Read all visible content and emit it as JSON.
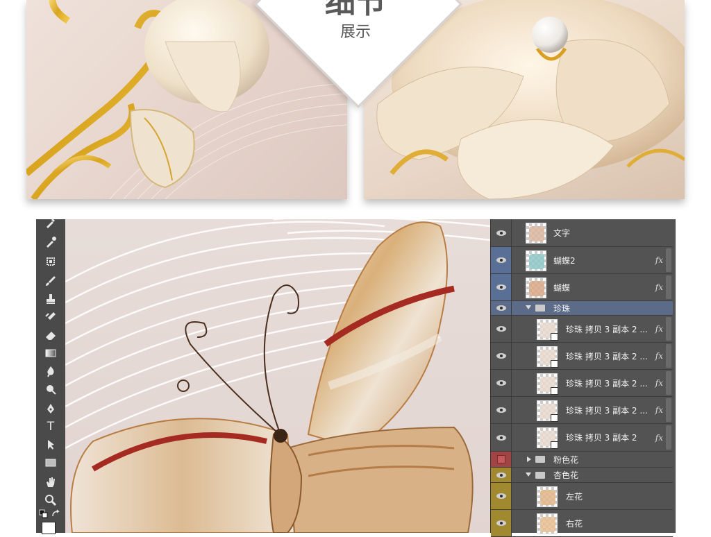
{
  "showcase": {
    "title": "细节",
    "subtitle": "展示"
  },
  "toolbar": {
    "tools": [
      {
        "name": "eyedropper-partial-icon",
        "glyph": "✒"
      },
      {
        "name": "eyedropper-icon",
        "glyph": "✎"
      },
      {
        "name": "spot-healing-icon",
        "glyph": "✺"
      },
      {
        "name": "brush-icon",
        "glyph": "✐"
      },
      {
        "name": "clone-stamp-icon",
        "glyph": "⊥"
      },
      {
        "name": "history-brush-icon",
        "glyph": "✍"
      },
      {
        "name": "eraser-icon",
        "glyph": "◪"
      },
      {
        "name": "gradient-icon",
        "glyph": "▭"
      },
      {
        "name": "blur-icon",
        "glyph": "◖"
      },
      {
        "name": "dodge-icon",
        "glyph": "●"
      },
      {
        "name": "pen-icon",
        "glyph": "✒"
      },
      {
        "name": "type-icon",
        "glyph": "T"
      },
      {
        "name": "path-selection-icon",
        "glyph": "▸"
      },
      {
        "name": "rectangle-icon",
        "glyph": "▭"
      },
      {
        "name": "hand-icon",
        "glyph": "✋"
      },
      {
        "name": "zoom-icon",
        "glyph": "⚲"
      },
      {
        "name": "swap-colors-icon",
        "glyph": "⇄"
      }
    ]
  },
  "layers": [
    {
      "label": "文字",
      "type": "layer",
      "fx": "",
      "eye": "normal"
    },
    {
      "label": "蝴蝶2",
      "type": "layer",
      "fx": "fx",
      "eye": "blue"
    },
    {
      "label": "蝴蝶",
      "type": "layer",
      "fx": "fx",
      "eye": "blue"
    },
    {
      "label": "珍珠",
      "type": "group-open",
      "fx": "",
      "eye": "normal"
    },
    {
      "label": "珍珠 拷贝 3 副本 2 ...",
      "type": "smart",
      "fx": "fx",
      "eye": "normal"
    },
    {
      "label": "珍珠 拷贝 3 副本 2 ...",
      "type": "smart",
      "fx": "fx",
      "eye": "normal"
    },
    {
      "label": "珍珠 拷贝 3 副本 2 ...",
      "type": "smart",
      "fx": "fx",
      "eye": "normal"
    },
    {
      "label": "珍珠 拷贝 3 副本 2 ...",
      "type": "smart",
      "fx": "fx",
      "eye": "normal"
    },
    {
      "label": "珍珠 拷贝 3 副本 2",
      "type": "smart",
      "fx": "fx",
      "eye": "normal"
    },
    {
      "label": "粉色花",
      "type": "group-closed",
      "fx": "",
      "eye": "red"
    },
    {
      "label": "杏色花",
      "type": "group-open",
      "fx": "",
      "eye": "gold"
    },
    {
      "label": "左花",
      "type": "layer",
      "fx": "",
      "eye": "gold"
    },
    {
      "label": "右花",
      "type": "layer",
      "fx": "",
      "eye": "gold"
    }
  ],
  "colors": {
    "panel_bg": "#535353",
    "selected_row": "#5a6f95",
    "gold_label": "#a0892e",
    "red_label": "#a04444"
  }
}
